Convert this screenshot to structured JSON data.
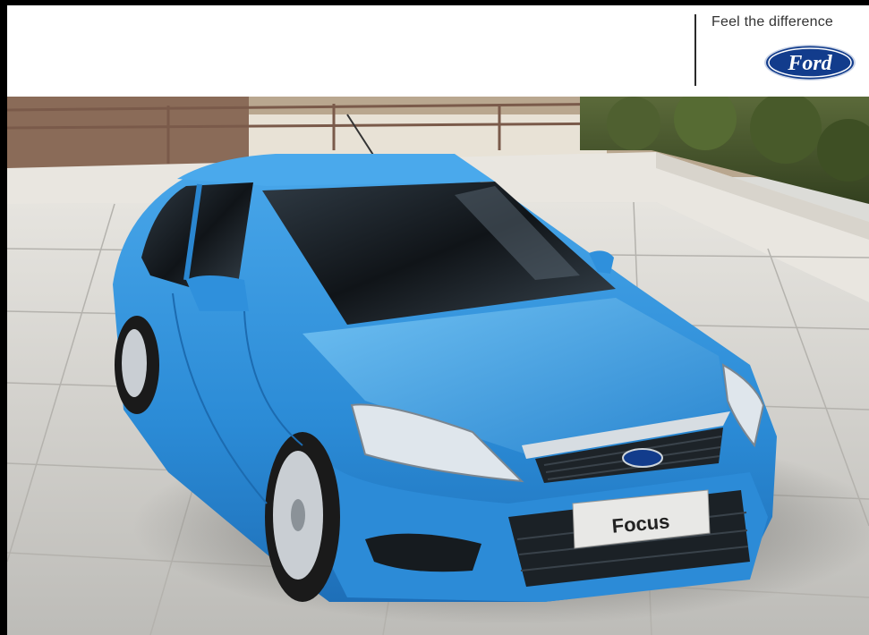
{
  "header": {
    "tagline": "Feel the difference",
    "logo_text": "Ford"
  },
  "car": {
    "plate_text": "Focus",
    "body_color": "#2f8fd8"
  },
  "colors": {
    "frame": "#000000",
    "header_bg": "#ffffff",
    "logo_blue": "#123c8c",
    "floor": "#d7d6d2"
  }
}
